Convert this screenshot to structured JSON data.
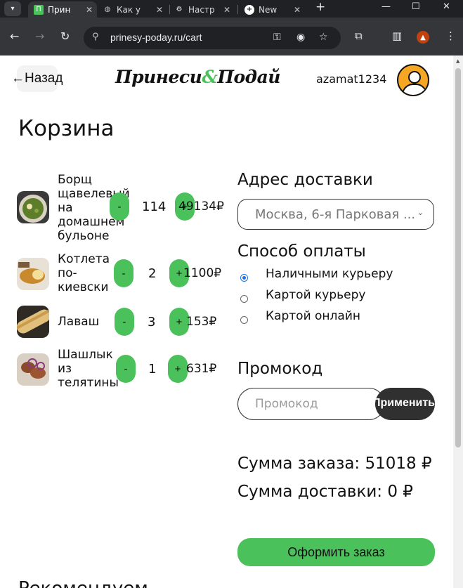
{
  "browser": {
    "tabs": [
      {
        "title": "Прин",
        "active": true
      },
      {
        "title": "Как у",
        "active": false
      },
      {
        "title": "Настр",
        "active": false
      },
      {
        "title": "New",
        "active": false
      }
    ],
    "url": "prinesy-poday.ru/cart"
  },
  "header": {
    "back_label": "Назад",
    "logo_left": "Принеси",
    "logo_amp": "&",
    "logo_right": "Подай",
    "username": "azamat1234"
  },
  "page_title": "Корзина",
  "cart": {
    "items": [
      {
        "name": "Борщ щавелевый на домашнем бульоне",
        "minus": "-",
        "qty": "114",
        "plus": "+",
        "price": "49134₽"
      },
      {
        "name": "Котлета по-киевски",
        "minus": "-",
        "qty": "2",
        "plus": "+",
        "price": "1100₽"
      },
      {
        "name": "Лаваш",
        "minus": "-",
        "qty": "3",
        "plus": "+",
        "price": "153₽"
      },
      {
        "name": "Шашлык из телятины",
        "minus": "-",
        "qty": "1",
        "plus": "+",
        "price": "631₽"
      }
    ]
  },
  "delivery": {
    "title": "Адрес доставки",
    "address": "Москва, 6-я Парковая ..."
  },
  "payment": {
    "title": "Способ оплаты",
    "options": [
      {
        "label": "Наличными курьеру",
        "checked": true
      },
      {
        "label": "Картой курьеру",
        "checked": false
      },
      {
        "label": "Картой онлайн",
        "checked": false
      }
    ]
  },
  "promo": {
    "title": "Промокод",
    "placeholder": "Промокод",
    "apply_label": "Применить"
  },
  "summary": {
    "order_sum": "Сумма заказа: 51018 ₽",
    "delivery_sum": "Сумма доставки: 0 ₽",
    "checkout_label": "Оформить заказ"
  },
  "recommend_title": "Рекомендуем",
  "colors": {
    "accent": "#4ac15a",
    "dark": "#303030"
  }
}
